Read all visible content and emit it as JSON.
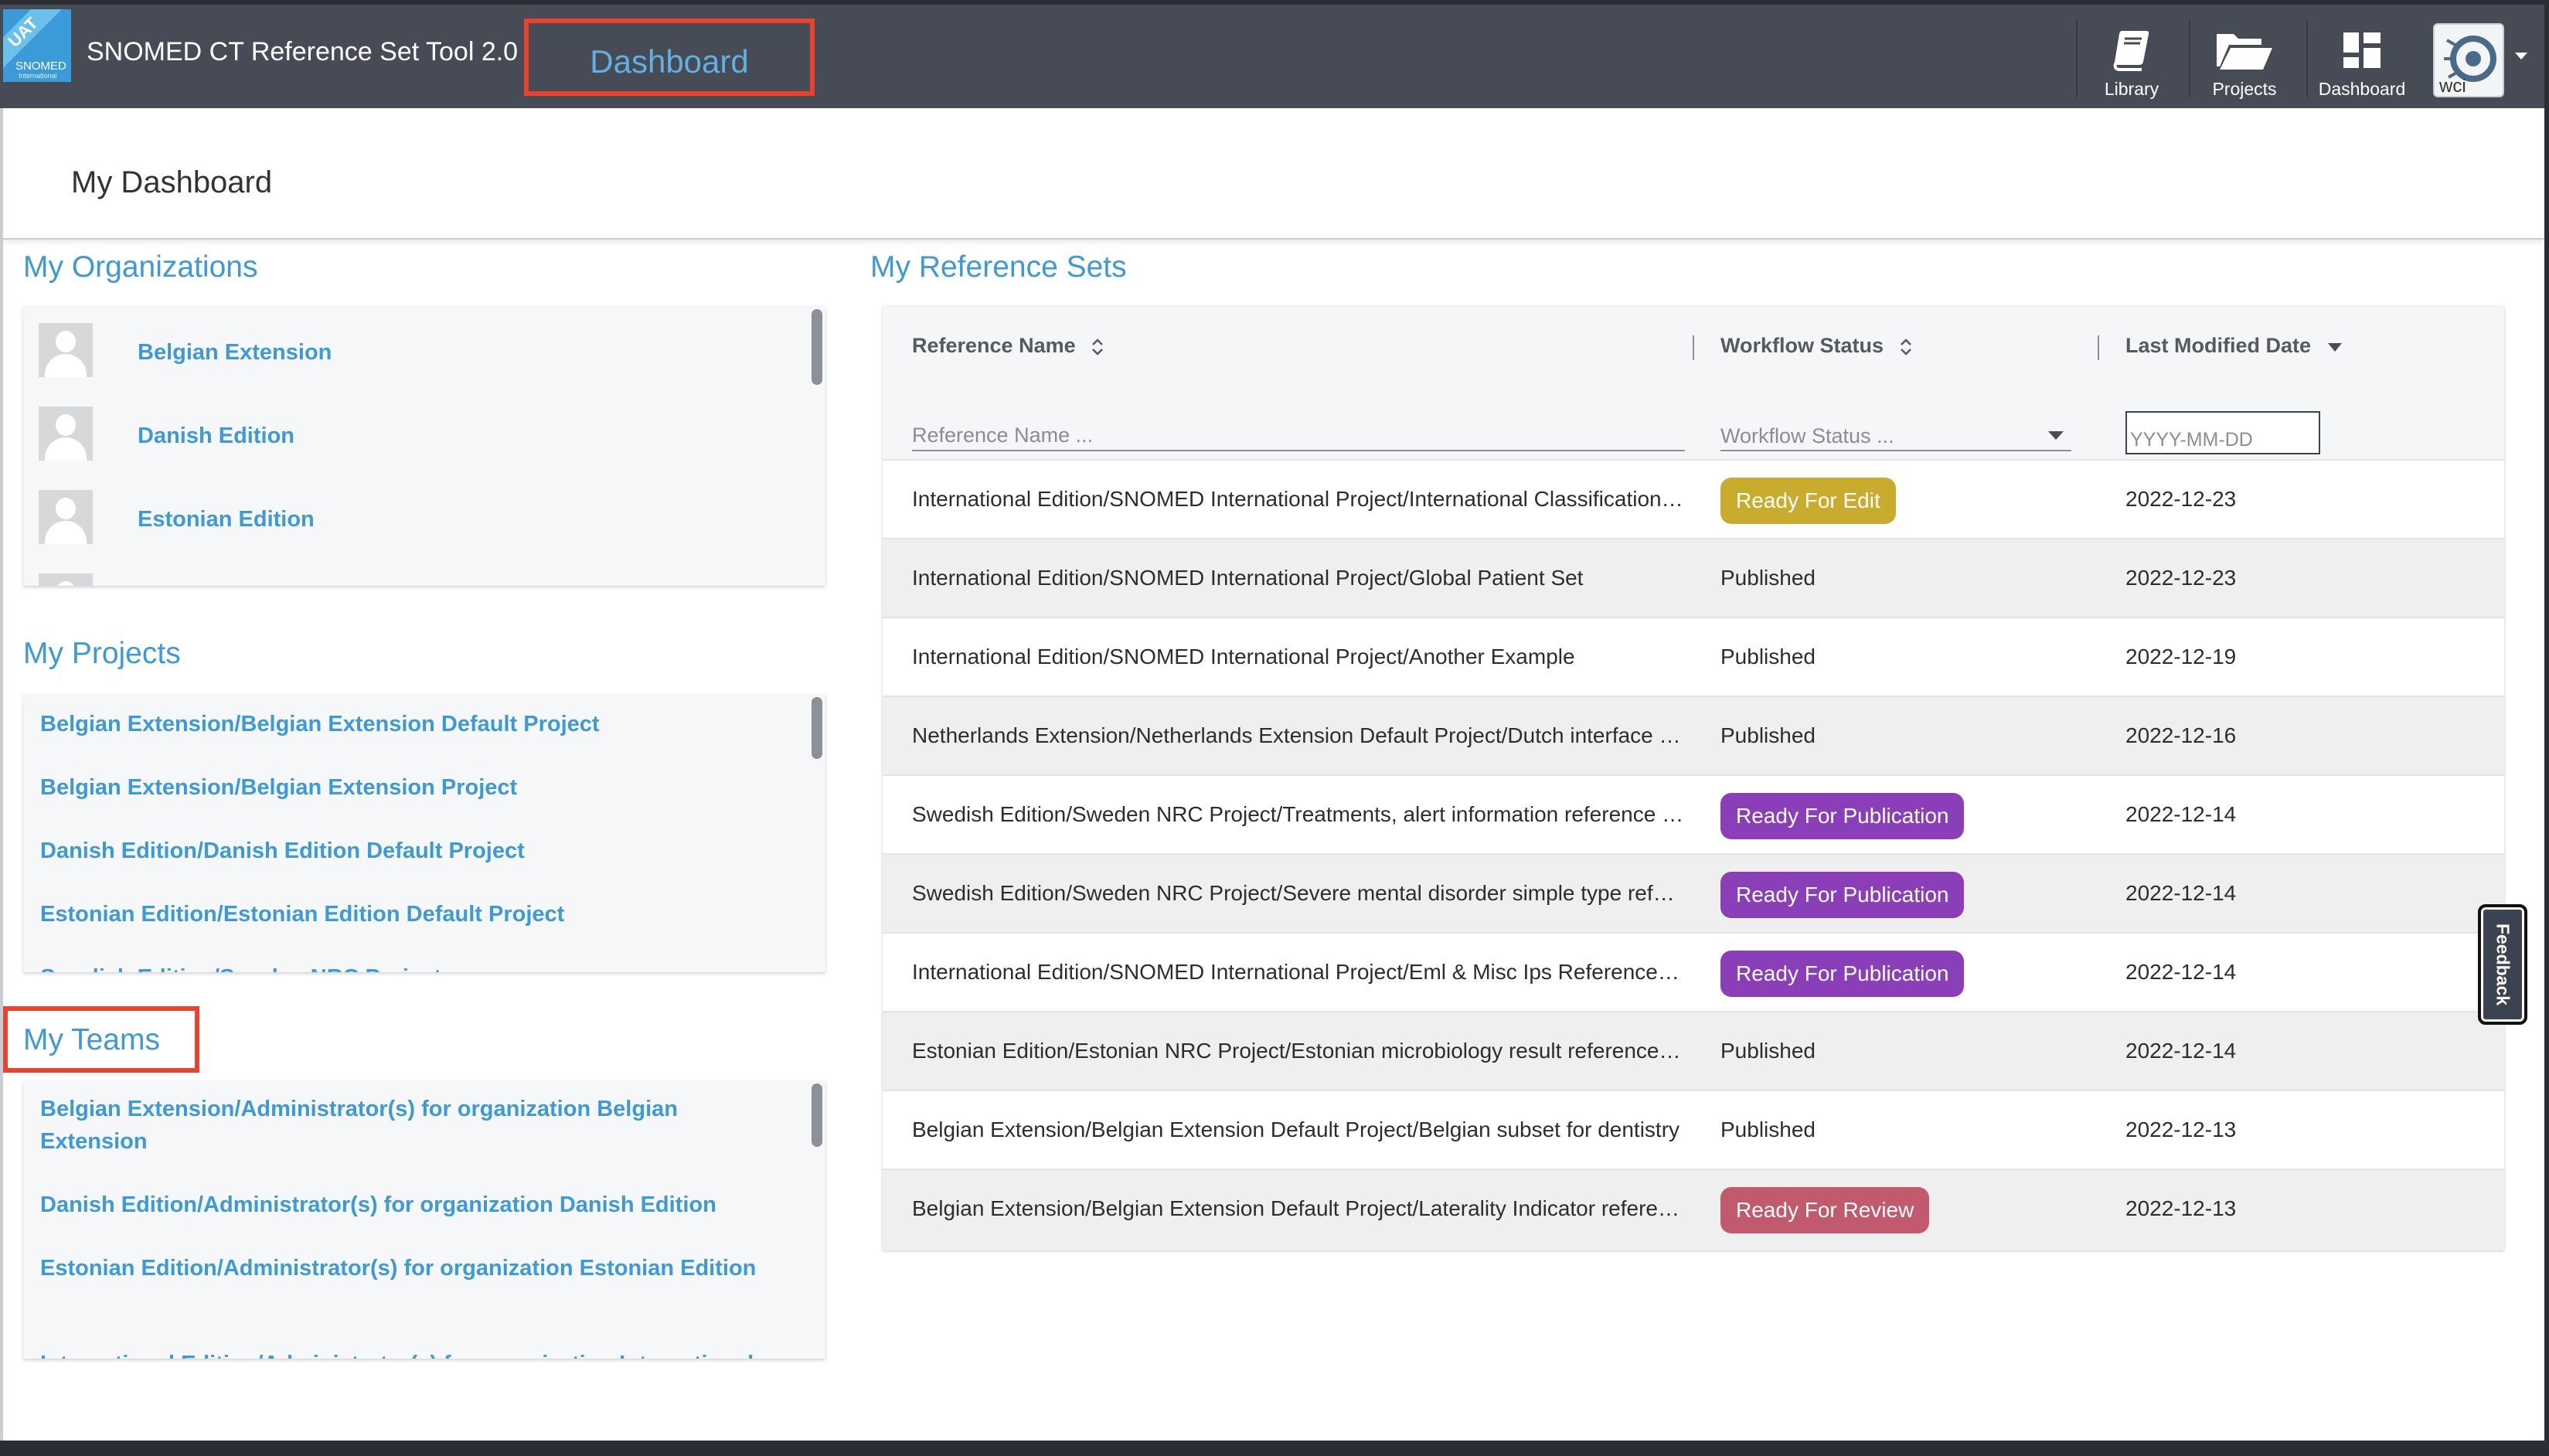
{
  "header": {
    "logo_ribbon": "UAT",
    "logo_text": "SNOMED",
    "logo_subtext": "International",
    "app_title": "SNOMED CT Reference Set Tool 2.0",
    "active_tab": "Dashboard",
    "nav": [
      {
        "label": "Library",
        "icon": "book-icon"
      },
      {
        "label": "Projects",
        "icon": "folder-open-icon"
      },
      {
        "label": "Dashboard",
        "icon": "dashboard-grid-icon"
      }
    ],
    "avatar_text": "wci"
  },
  "page": {
    "title": "My Dashboard"
  },
  "organizations": {
    "title": "My Organizations",
    "items": [
      "Belgian Extension",
      "Danish Edition",
      "Estonian Edition"
    ]
  },
  "projects": {
    "title": "My Projects",
    "items": [
      "Belgian Extension/Belgian Extension Default Project",
      "Belgian Extension/Belgian Extension Project",
      "Danish Edition/Danish Edition Default Project",
      "Estonian Edition/Estonian Edition Default Project",
      "Swedish Edition/Sweden NRC Project"
    ]
  },
  "teams": {
    "title": "My Teams",
    "items": [
      "Belgian Extension/Administrator(s) for organization Belgian Extension",
      "Danish Edition/Administrator(s) for organization Danish Edition",
      "Estonian Edition/Administrator(s) for organization Estonian Edition",
      "International Edition/Administrator(s) for organization International Edition"
    ]
  },
  "refsets": {
    "title": "My Reference Sets",
    "columns": {
      "name": "Reference Name",
      "status": "Workflow Status",
      "date": "Last Modified Date"
    },
    "filters": {
      "name_placeholder": "Reference Name ...",
      "status_placeholder": "Workflow Status ...",
      "date_placeholder": "YYYY-MM-DD"
    },
    "rows": [
      {
        "name": "International Edition/SNOMED International Project/International Classification of Diseases",
        "status": "Ready For Edit",
        "date": "2022-12-23"
      },
      {
        "name": "International Edition/SNOMED International Project/Global Patient Set",
        "status": "Published",
        "date": "2022-12-23"
      },
      {
        "name": "International Edition/SNOMED International Project/Another Example",
        "status": "Published",
        "date": "2022-12-19"
      },
      {
        "name": "Netherlands Extension/Netherlands Extension Default Project/Dutch interface terminology",
        "status": "Published",
        "date": "2022-12-16"
      },
      {
        "name": "Swedish Edition/Sweden NRC Project/Treatments, alert information reference set",
        "status": "Ready For Publication",
        "date": "2022-12-14"
      },
      {
        "name": "Swedish Edition/Sweden NRC Project/Severe mental disorder simple type reference set",
        "status": "Ready For Publication",
        "date": "2022-12-14"
      },
      {
        "name": "International Edition/SNOMED International Project/Eml & Misc Ips Reference Set",
        "status": "Ready For Publication",
        "date": "2022-12-14"
      },
      {
        "name": "Estonian Edition/Estonian NRC Project/Estonian microbiology result reference set",
        "status": "Published",
        "date": "2022-12-14"
      },
      {
        "name": "Belgian Extension/Belgian Extension Default Project/Belgian subset for dentistry",
        "status": "Published",
        "date": "2022-12-13"
      },
      {
        "name": "Belgian Extension/Belgian Extension Default Project/Laterality Indicator reference set",
        "status": "Ready For Review",
        "date": "2022-12-13"
      }
    ]
  },
  "feedback_label": "Feedback",
  "colors": {
    "header_bg": "#474b55",
    "accent_blue": "#3d9ad6",
    "highlight_red": "#e8432e",
    "ready_for_edit": "#c9ac2e",
    "ready_for_publication": "#8a3fb8",
    "ready_for_review": "#c15a6c"
  }
}
